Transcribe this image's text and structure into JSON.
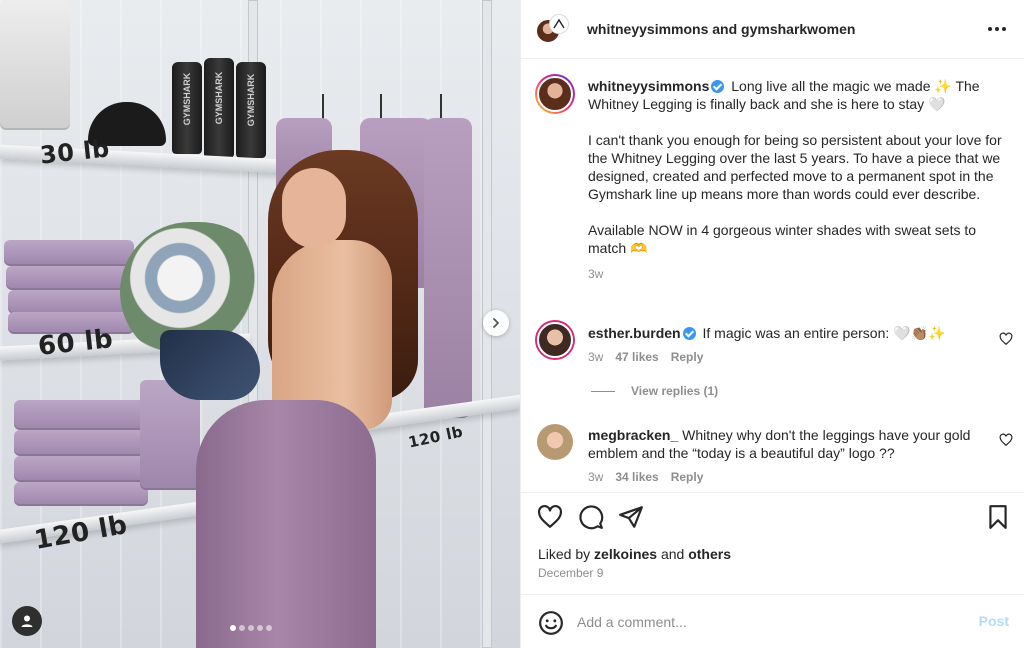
{
  "media": {
    "shelf_labels": [
      "30 lb",
      "60 lb",
      "120 lb",
      "120 lb"
    ],
    "bottle_brand": "GYMSHARK",
    "carousel": {
      "total": 5,
      "active": 1
    },
    "icons": {
      "next": "chevron-right-icon",
      "tagged_user": "user-icon"
    }
  },
  "header": {
    "title": "whitneyysimmons and gymsharkwomen",
    "more_icon": "more-horizontal-icon"
  },
  "caption": {
    "username": "whitneyysimmons",
    "verified": true,
    "paragraphs": [
      "Long live all the magic we made ✨ The Whitney Legging is finally back and she is here to stay 🤍",
      "I can't thank you enough for being so persistent about your love for the Whitney Legging over the last 5 years. To have a piece that we designed, created and perfected move to a permanent spot in the Gymshark line up means more than words could ever describe.",
      "Available NOW in 4 gorgeous winter shades with sweat sets to match 🫶"
    ],
    "time": "3w"
  },
  "comments": [
    {
      "username": "esther.burden",
      "verified": true,
      "text": "If magic was an entire person: 🤍👏🏽✨",
      "time": "3w",
      "likes": "47 likes",
      "reply": "Reply",
      "view_replies": "View replies (1)"
    },
    {
      "username": "megbracken_",
      "verified": false,
      "text": "Whitney why don't the leggings have your gold emblem and the “today is a beautiful day” logo ??",
      "time": "3w",
      "likes": "34 likes",
      "reply": "Reply"
    }
  ],
  "actions": {
    "icons": [
      "heart-icon",
      "comment-icon",
      "share-icon",
      "bookmark-icon"
    ],
    "liked_by_prefix": "Liked by",
    "liked_by_user": "zelkoines",
    "liked_by_and": "and",
    "liked_by_others": "others",
    "date": "December 9"
  },
  "comment_box": {
    "placeholder": "Add a comment...",
    "post_label": "Post",
    "emoji_icon": "emoji-icon"
  },
  "colors": {
    "text": "#262626",
    "muted": "#8e8e8e",
    "verified": "#3897f0",
    "post_disabled": "#b3dbff",
    "legging": "#a786a9"
  }
}
